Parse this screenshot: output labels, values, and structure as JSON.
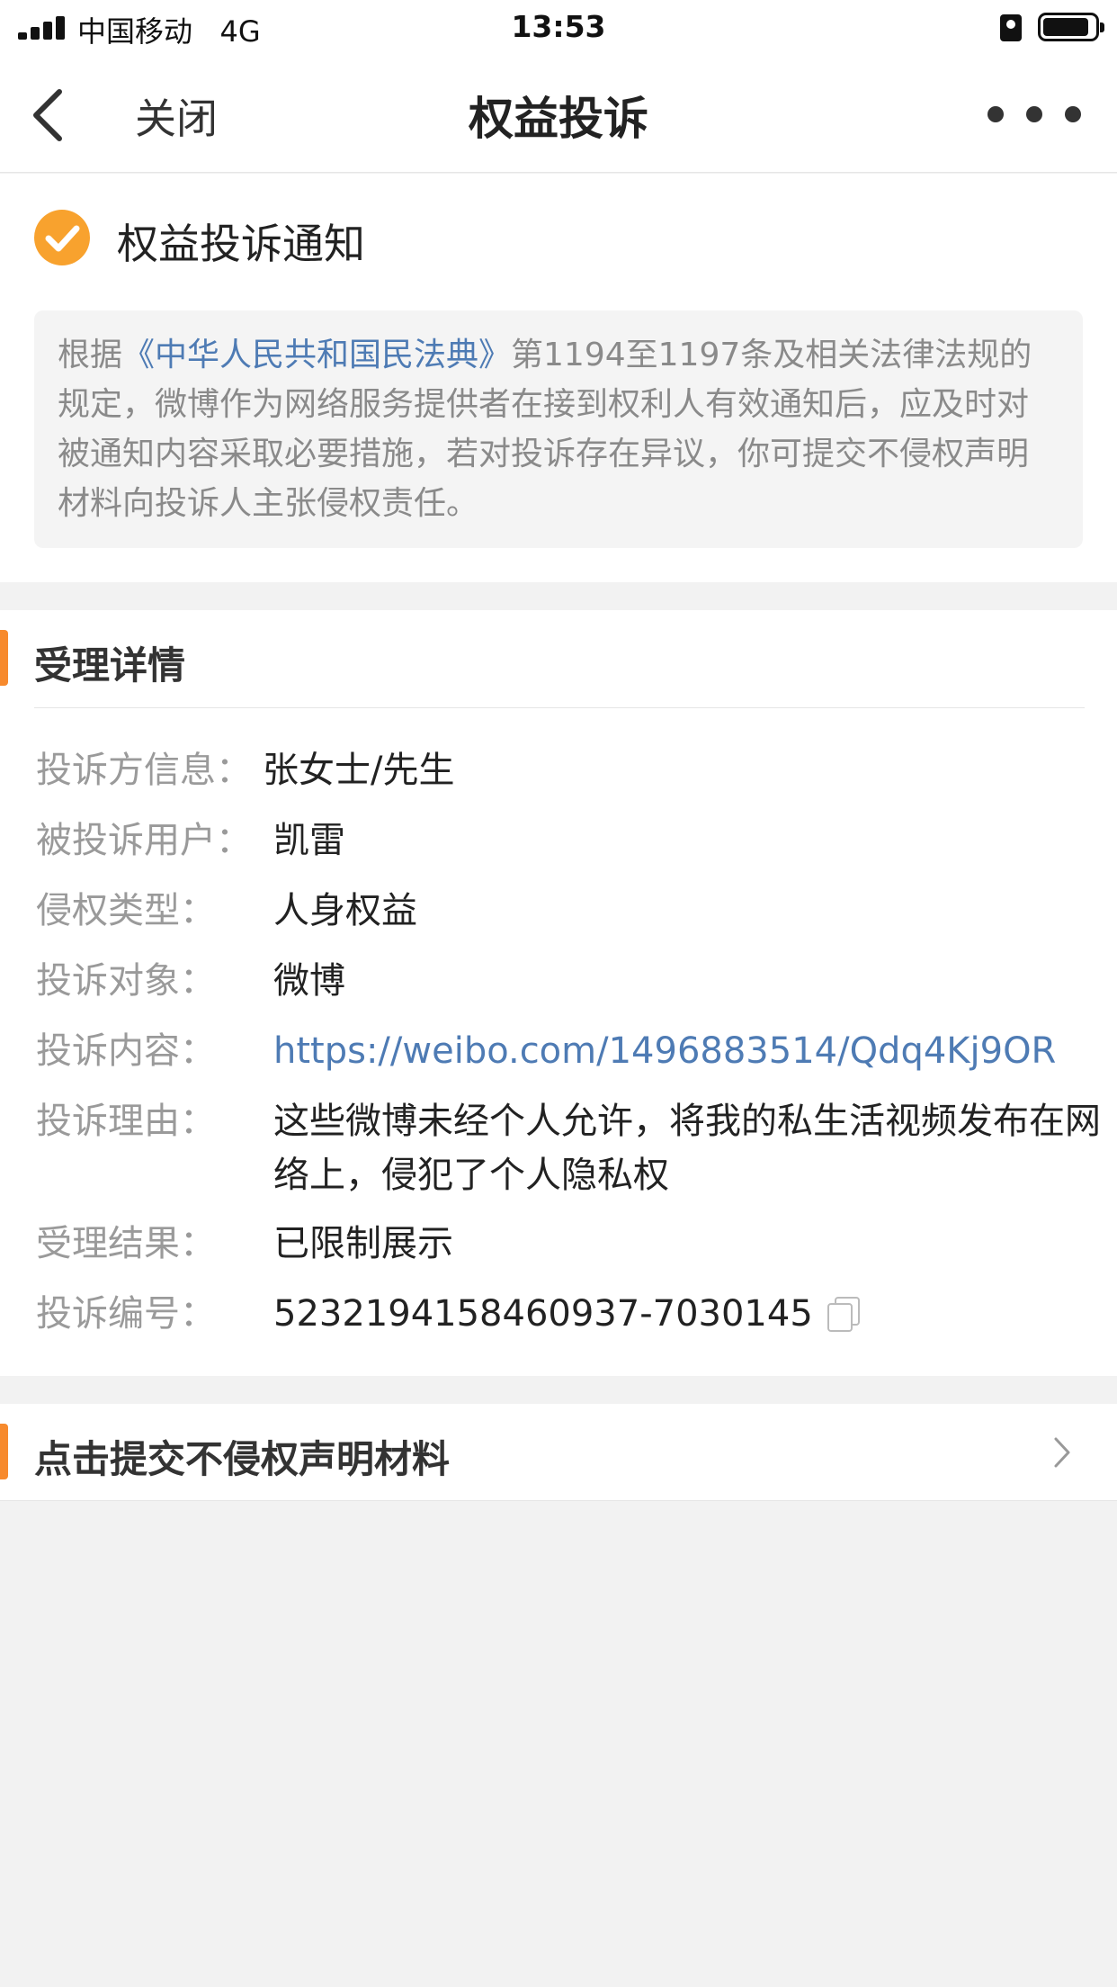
{
  "status_bar": {
    "carrier": "中国移动",
    "network": "4G",
    "time": "13:53"
  },
  "nav": {
    "close_label": "关闭",
    "title": "权益投诉"
  },
  "notice": {
    "title": "权益投诉通知",
    "text_prefix": "根据",
    "law_name": "《中华人民共和国民法典》",
    "text_suffix": "第1194至1197条及相关法律法规的规定，微博作为网络服务提供者在接到权利人有效通知后，应及时对被通知内容采取必要措施，若对投诉存在异议，你可提交不侵权声明材料向投诉人主张侵权责任。"
  },
  "details": {
    "section_title": "受理详情",
    "rows": [
      {
        "label": "投诉方信息：",
        "value": "张女士/先生"
      },
      {
        "label": "被投诉用户：",
        "value": "凯雷"
      },
      {
        "label": "侵权类型：",
        "value": "人身权益"
      },
      {
        "label": "投诉对象：",
        "value": "微博"
      },
      {
        "label": "投诉内容：",
        "value": "https://weibo.com/1496883514/Qdq4Kj9OR"
      },
      {
        "label": "投诉理由：",
        "value": "这些微博未经个人允许，将我的私生活视频发布在网络上，侵犯了个人隐私权"
      },
      {
        "label": "受理结果：",
        "value": "已限制展示"
      },
      {
        "label": "投诉编号：",
        "value": "5232194158460937-7030145"
      }
    ]
  },
  "submit": {
    "label": "点击提交不侵权声明材料"
  },
  "colors": {
    "accent": "#f78a2d",
    "link": "#4e7bb4",
    "check": "#f8a22e"
  },
  "icons": [
    "signal-icon",
    "lock-rotation-icon",
    "battery-icon",
    "back-chevron-icon",
    "more-dots-icon",
    "check-circle-icon",
    "copy-icon",
    "chevron-right-icon"
  ]
}
